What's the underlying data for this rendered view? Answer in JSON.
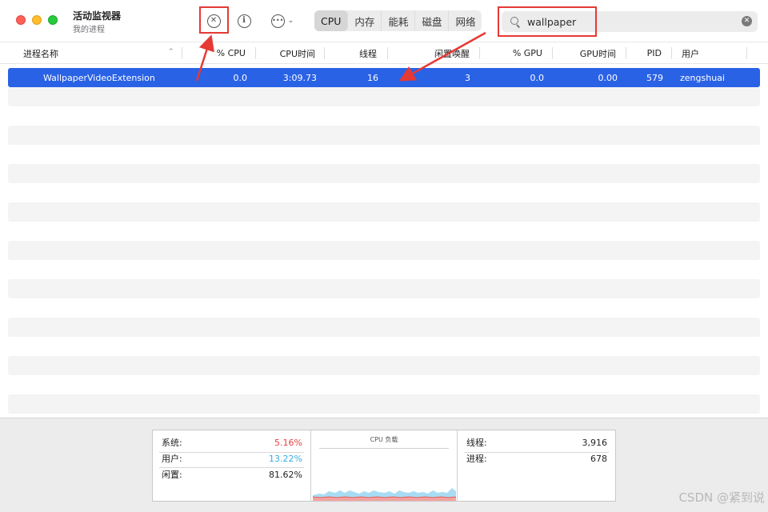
{
  "window": {
    "title": "活动监视器",
    "subtitle": "我的进程"
  },
  "toolbar": {
    "stop_icon": "stop-process-icon",
    "info_icon": "info-icon",
    "more_icon": "more-options-icon",
    "tabs": [
      "CPU",
      "内存",
      "能耗",
      "磁盘",
      "网络"
    ],
    "active_tab": "CPU"
  },
  "search": {
    "value": "wallpaper"
  },
  "table": {
    "columns": [
      "进程名称",
      "% CPU",
      "CPU时间",
      "线程",
      "闲置唤醒",
      "% GPU",
      "GPU时间",
      "PID",
      "用户"
    ],
    "sort_column": "进程名称",
    "rows": [
      {
        "name": "WallpaperVideoExtension",
        "cpu": "0.0",
        "cpu_time": "3:09.73",
        "threads": "16",
        "idle_wakeups": "3",
        "gpu": "0.0",
        "gpu_time": "0.00",
        "pid": "579",
        "user": "zengshuai"
      }
    ]
  },
  "stats": {
    "system_label": "系统:",
    "system_value": "5.16%",
    "user_label": "用户:",
    "user_value": "13.22%",
    "idle_label": "闲置:",
    "idle_value": "81.62%",
    "chart_title": "CPU 负载",
    "threads_label": "线程:",
    "threads_value": "3,916",
    "processes_label": "进程:",
    "processes_value": "678"
  },
  "colors": {
    "selection": "#2a62e6",
    "system": "#e8413c",
    "user": "#35aee1",
    "annotation": "#e53935"
  },
  "watermark": "CSDN @紧到说"
}
